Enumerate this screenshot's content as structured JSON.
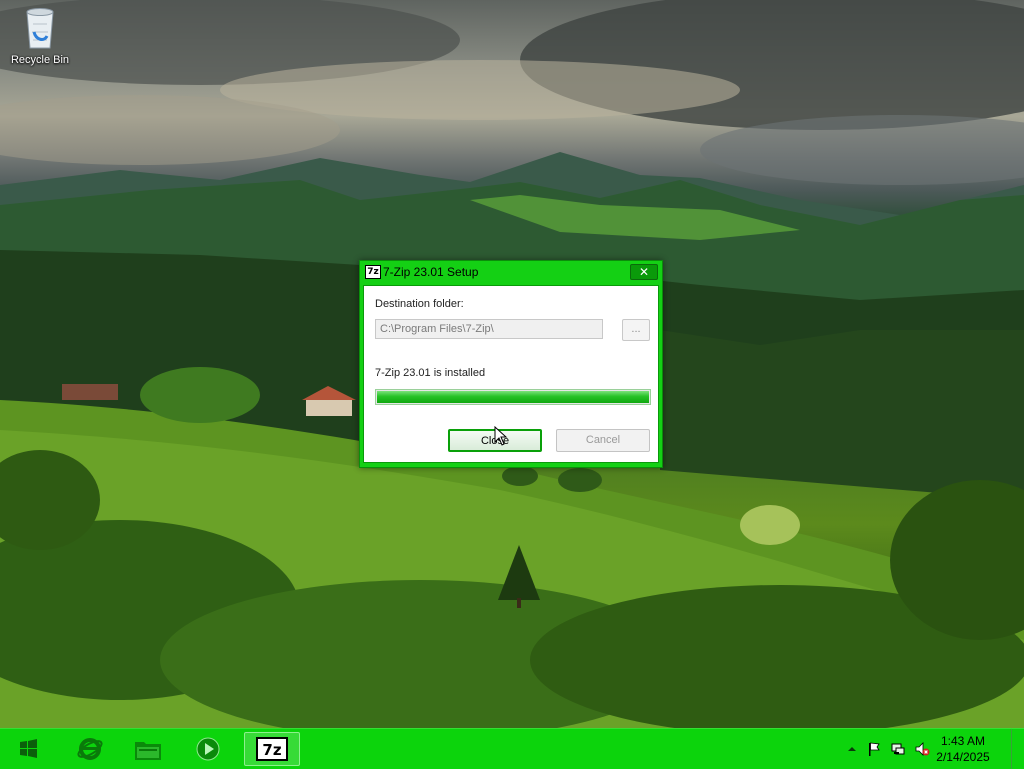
{
  "desktop": {
    "icons": [
      {
        "label": "Recycle Bin",
        "icon": "recycle-bin-icon"
      }
    ]
  },
  "dialog": {
    "title": "7-Zip 23.01 Setup",
    "app_icon_text": "7z",
    "close_glyph": "✕",
    "destination_label": "Destination folder:",
    "destination_value": "C:\\Program Files\\7-Zip\\",
    "browse_label": "...",
    "status_text": "7-Zip 23.01 is installed",
    "progress": 1.0,
    "buttons": {
      "close": "Close",
      "cancel": "Cancel"
    }
  },
  "taskbar": {
    "start_icon": "windows-logo-icon",
    "pinned": [
      {
        "name": "internet-explorer",
        "icon": "internet-explorer-icon"
      },
      {
        "name": "file-explorer",
        "icon": "folder-icon"
      },
      {
        "name": "media-player",
        "icon": "media-player-icon"
      },
      {
        "name": "7-zip-setup",
        "icon": "7zip-icon",
        "label": "7z",
        "active": true
      }
    ],
    "tray": {
      "icons": [
        "show-hidden-icons",
        "flag-icon",
        "network-icon",
        "volume-muted-icon"
      ],
      "time": "1:43 AM",
      "date": "2/14/2025"
    }
  },
  "colors": {
    "accent": "#14d014",
    "taskbar": "#0cd40c",
    "progress": "#14b814"
  }
}
